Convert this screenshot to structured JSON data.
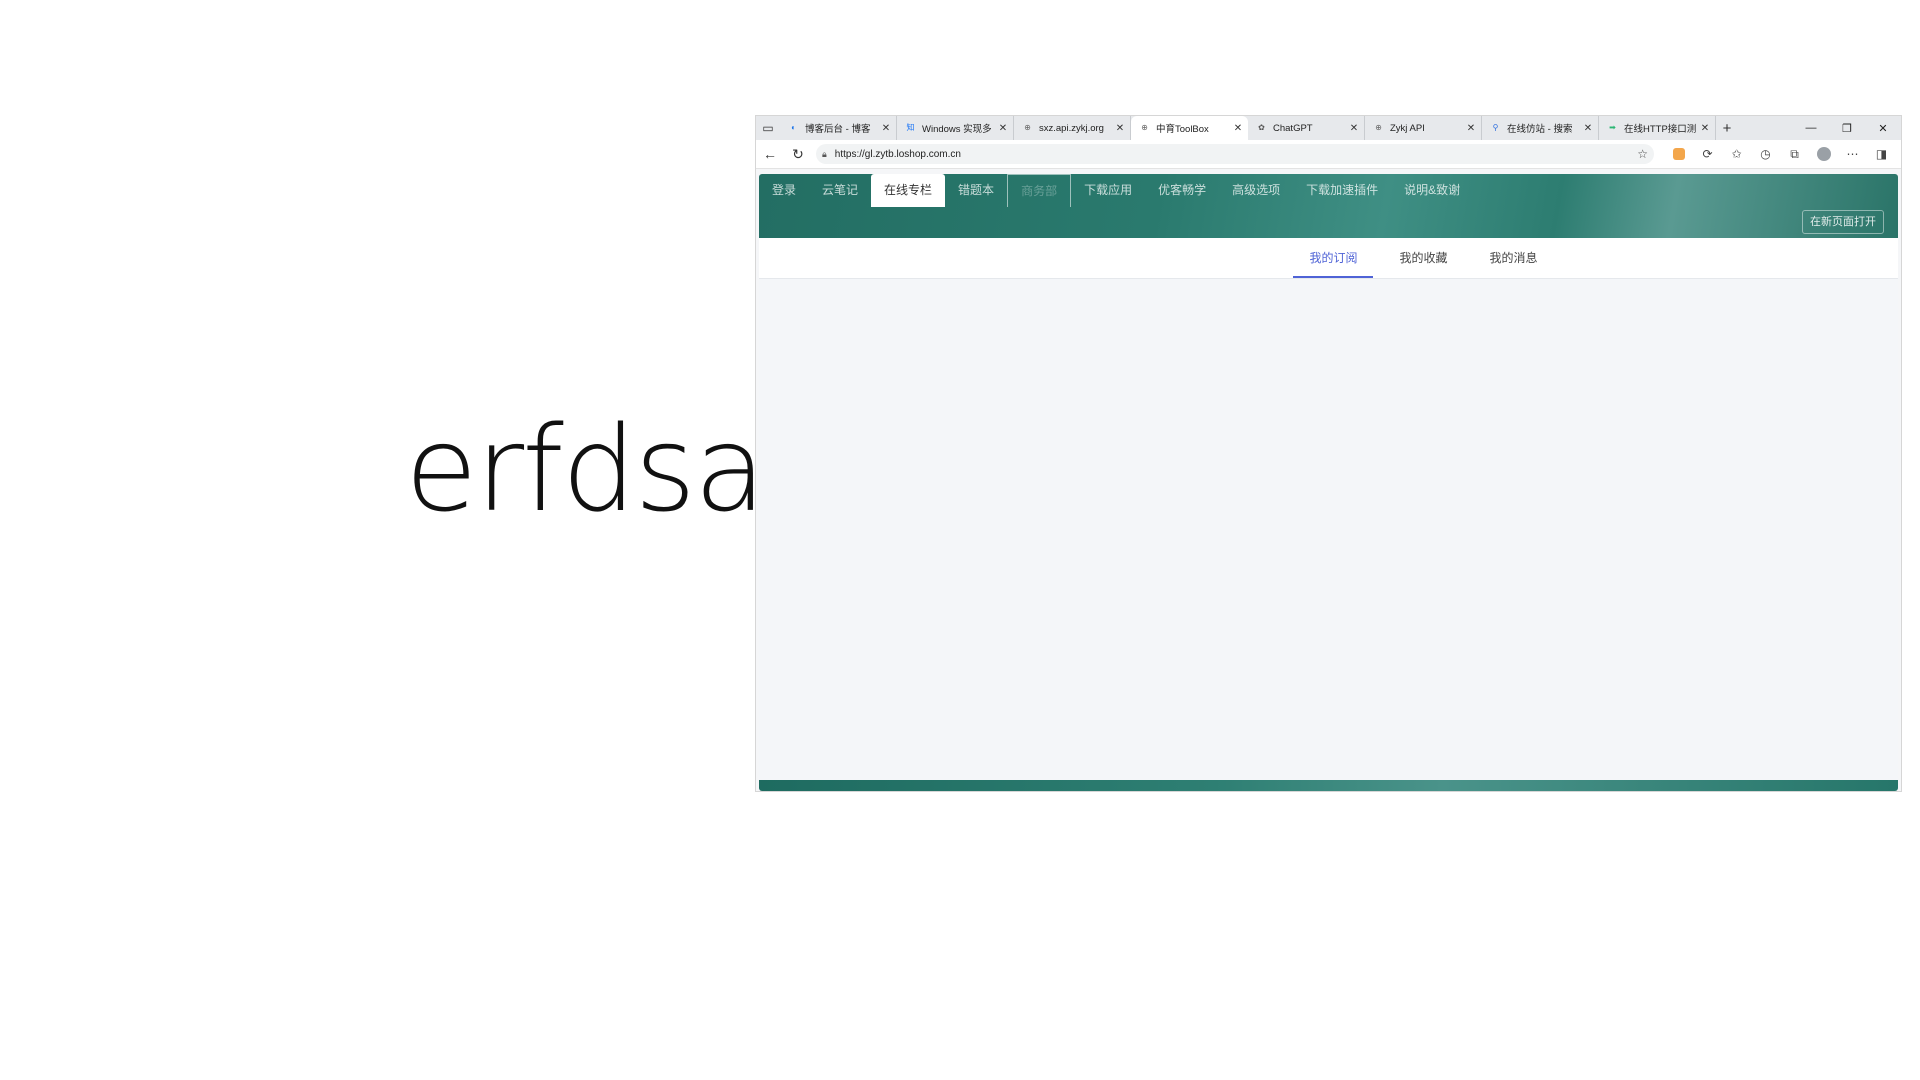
{
  "background_text": "erfdsah",
  "browser": {
    "tabs": [
      {
        "label": "博客后台 - 博客",
        "icon": "blog-favicon",
        "color": "#1a73e8",
        "glyph": "◐"
      },
      {
        "label": "Windows 实现多",
        "icon": "zhihu-favicon",
        "color": "#1772f6",
        "glyph": "知"
      },
      {
        "label": "sxz.api.zykj.org",
        "icon": "globe-icon",
        "color": "#666666",
        "glyph": "⊕"
      },
      {
        "label": "中育ToolBox",
        "icon": "globe-icon",
        "color": "#666666",
        "glyph": "⊕",
        "active": true
      },
      {
        "label": "ChatGPT",
        "icon": "chatgpt-icon",
        "color": "#555555",
        "glyph": "✿"
      },
      {
        "label": "Zykj API",
        "icon": "globe-icon",
        "color": "#666666",
        "glyph": "⊕"
      },
      {
        "label": "在线仿站 - 搜索",
        "icon": "search-icon",
        "color": "#2f6fde",
        "glyph": "⚲"
      },
      {
        "label": "在线HTTP接口测",
        "icon": "api-favicon",
        "color": "#2bb673",
        "glyph": "➡"
      }
    ],
    "new_tab": "+",
    "address": {
      "url": "https://gl.zytb.loshop.com.cn"
    }
  },
  "page": {
    "nav": [
      {
        "label": "登录",
        "state": "normal"
      },
      {
        "label": "云笔记",
        "state": "normal"
      },
      {
        "label": "在线专栏",
        "state": "active"
      },
      {
        "label": "错题本",
        "state": "normal"
      },
      {
        "label": "商务部",
        "state": "outlined"
      },
      {
        "label": "下载应用",
        "state": "normal"
      },
      {
        "label": "优客畅学",
        "state": "normal"
      },
      {
        "label": "高级选项",
        "state": "normal"
      },
      {
        "label": "下载加速插件",
        "state": "normal"
      },
      {
        "label": "说明&致谢",
        "state": "normal"
      }
    ],
    "open_new_label": "在新页面打开",
    "subtabs": [
      {
        "label": "我的订阅",
        "active": true
      },
      {
        "label": "我的收藏",
        "active": false
      },
      {
        "label": "我的消息",
        "active": false
      }
    ]
  },
  "colors": {
    "header": "#2a7a6e",
    "accent": "#4f63d6",
    "page_bg": "#f4f6f9"
  }
}
